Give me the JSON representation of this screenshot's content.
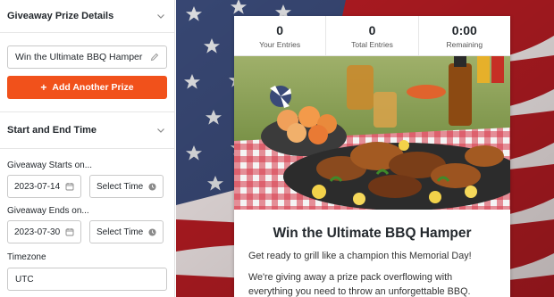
{
  "sidebar": {
    "prize_section": {
      "title": "Giveaway Prize Details"
    },
    "prize_name": {
      "value": "Win the Ultimate BBQ Hamper"
    },
    "add_prize": {
      "label": "Add Another Prize"
    },
    "time_section": {
      "title": "Start and End Time"
    },
    "starts": {
      "label": "Giveaway Starts on...",
      "date": "2023-07-14",
      "time": "Select Time"
    },
    "ends": {
      "label": "Giveaway Ends on...",
      "date": "2023-07-30",
      "time": "Select Time"
    },
    "timezone": {
      "label": "Timezone",
      "value": "UTC"
    }
  },
  "preview": {
    "stats": [
      {
        "value": "0",
        "label": "Your Entries"
      },
      {
        "value": "0",
        "label": "Total Entries"
      },
      {
        "value": "0:00",
        "label": "Remaining"
      }
    ],
    "title": "Win the Ultimate BBQ Hamper",
    "intro": "Get ready to grill like a champion this Memorial Day!",
    "body": "We're giving away a prize pack overflowing with everything you need to throw an unforgettable BBQ."
  },
  "colors": {
    "accent": "#f1511b",
    "flag_red": "#b81c23",
    "flag_blue": "#3a4a78"
  }
}
